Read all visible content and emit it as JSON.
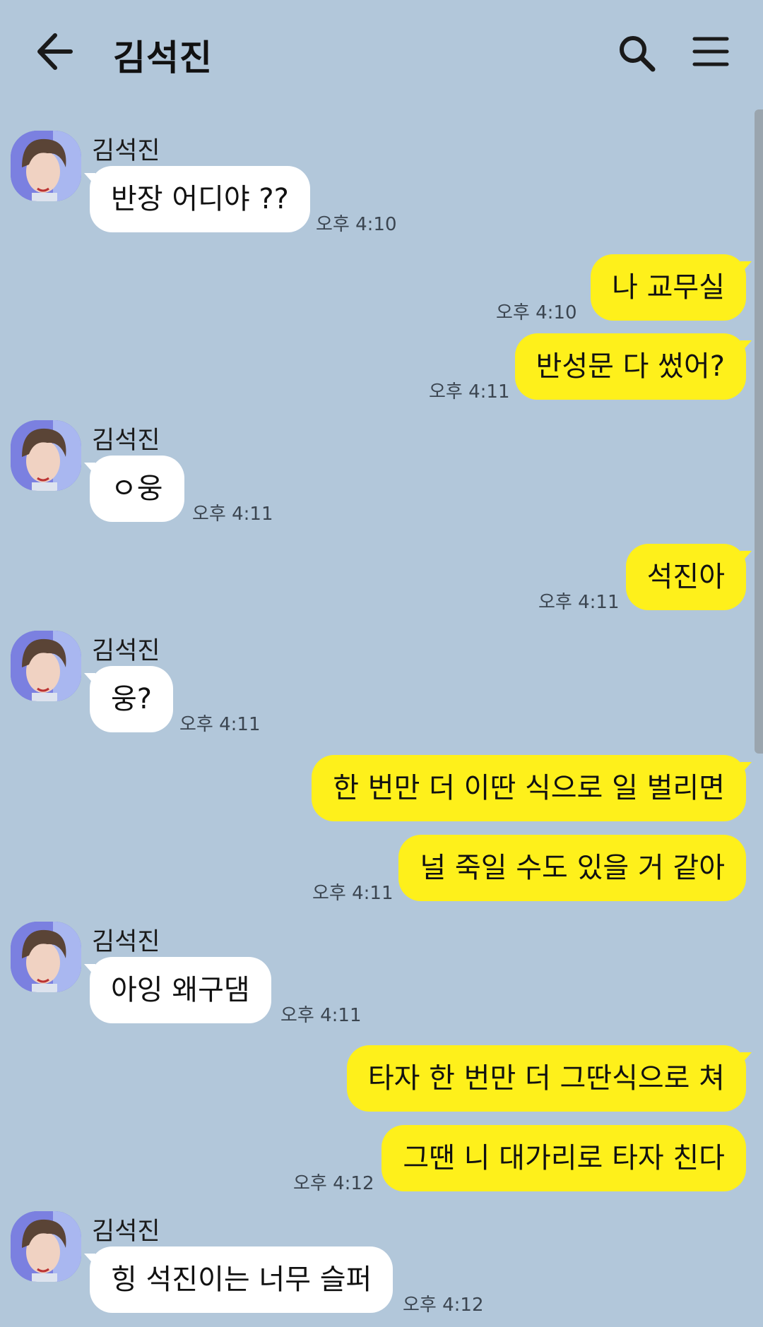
{
  "header": {
    "title": "김석진",
    "back_icon": "arrow-left-icon",
    "search_icon": "search-icon",
    "menu_icon": "hamburger-menu-icon"
  },
  "colors": {
    "background": "#b2c7da",
    "incoming_bubble": "#ffffff",
    "outgoing_bubble": "#fef01b"
  },
  "messages": [
    {
      "side": "in",
      "sender": "김석진",
      "text": "반장 어디야 ??",
      "time": "오후 4:10"
    },
    {
      "side": "out",
      "text": "나 교무실",
      "time": "오후 4:10"
    },
    {
      "side": "out",
      "text": "반성문 다 썼어?",
      "time": "오후 4:11"
    },
    {
      "side": "in",
      "sender": "김석진",
      "text": "ㅇ웅",
      "time": "오후 4:11"
    },
    {
      "side": "out",
      "text": "석진아",
      "time": "오후 4:11"
    },
    {
      "side": "in",
      "sender": "김석진",
      "text": "웅?",
      "time": "오후 4:11"
    },
    {
      "side": "out",
      "text": "한 번만 더 이딴 식으로 일 벌리면",
      "time": ""
    },
    {
      "side": "out",
      "text": "널 죽일 수도 있을 거 같아",
      "time": "오후 4:11"
    },
    {
      "side": "in",
      "sender": "김석진",
      "text": "아잉 왜구댐",
      "time": "오후 4:11"
    },
    {
      "side": "out",
      "text": "타자 한 번만 더 그딴식으로 쳐",
      "time": ""
    },
    {
      "side": "out",
      "text": "그땐 니 대가리로 타자 친다",
      "time": "오후 4:12"
    },
    {
      "side": "in",
      "sender": "김석진",
      "text": "힝 석진이는 너무 슬퍼",
      "time": "오후 4:12"
    }
  ]
}
